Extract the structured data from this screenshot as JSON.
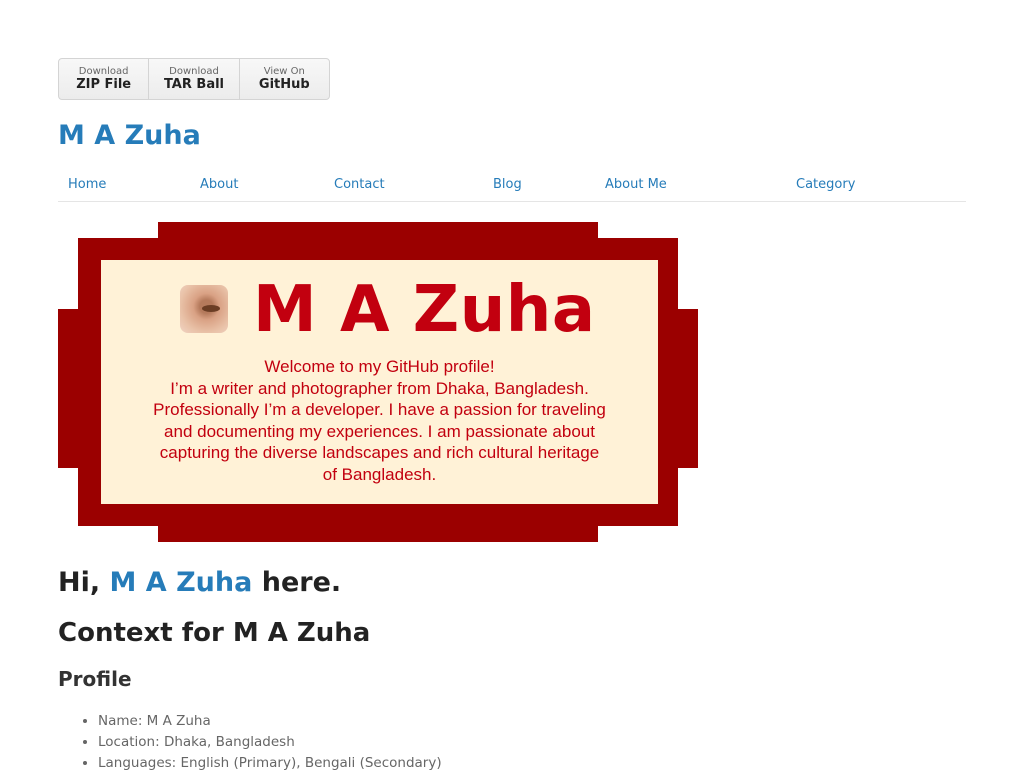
{
  "downloads": [
    {
      "small": "Download",
      "big": "ZIP File"
    },
    {
      "small": "Download",
      "big": "TAR Ball"
    },
    {
      "small": "View On",
      "big": "GitHub"
    }
  ],
  "site_title": "M A Zuha",
  "nav": [
    "Home",
    "About",
    "Contact",
    "Blog",
    "About Me",
    "Category"
  ],
  "banner": {
    "name": "M A Zuha",
    "lines": [
      "Welcome to my GitHub profile!",
      "I’m a writer and photographer from Dhaka, Bangladesh.",
      "Professionally I’m a developer. I have a passion for traveling",
      "and documenting my experiences. I am passionate about",
      "capturing the diverse landscapes and rich cultural heritage",
      "of Bangladesh."
    ],
    "frame_color": "#9b0000",
    "inner_color": "#fff2d7",
    "text_color": "#c2000f"
  },
  "heading": {
    "prefix": "Hi, ",
    "name": "M A Zuha",
    "suffix": " here."
  },
  "context_title": "Context for M A Zuha",
  "profile_title": "Profile",
  "profile_items": [
    "Name: M A Zuha",
    "Location: Dhaka, Bangladesh",
    "Languages: English (Primary), Bengali (Secondary)"
  ],
  "colors": {
    "link": "#267cb9",
    "heading": "#222222"
  }
}
